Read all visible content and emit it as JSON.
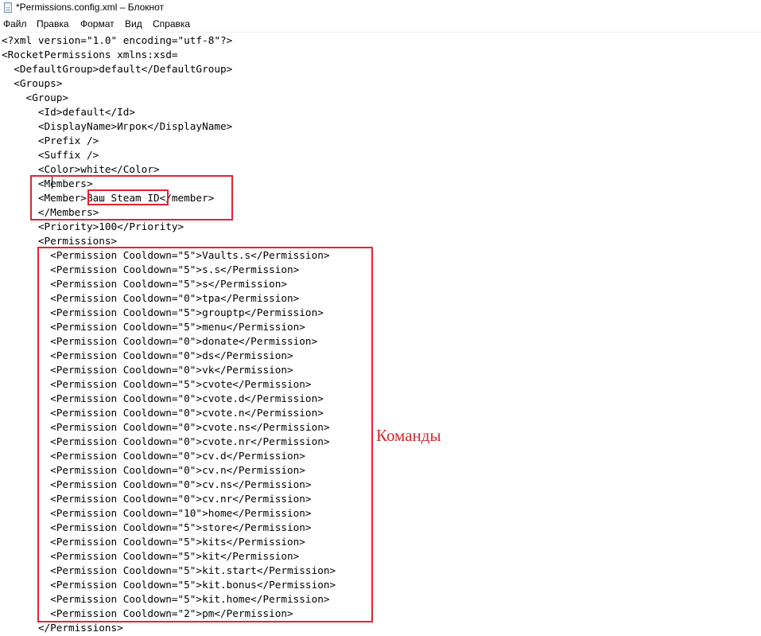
{
  "window": {
    "title": "*Permissions.config.xml – Блокнот",
    "icon": "notepad-icon"
  },
  "menu": [
    "Файл",
    "Правка",
    "Формат",
    "Вид",
    "Справка"
  ],
  "editor": {
    "lines": [
      "<?xml version=\"1.0\" encoding=\"utf-8\"?>",
      "<RocketPermissions xmlns:xsd=",
      "  <DefaultGroup>default</DefaultGroup>",
      "  <Groups>",
      "    <Group>",
      "      <Id>default</Id>",
      "      <DisplayName>Игрок</DisplayName>",
      "      <Prefix />",
      "      <Suffix />",
      "      <Color>white</Color>",
      "      <Members>",
      "      <Member>Ваш Steam ID</member>",
      "      </Members>",
      "      <Priority>100</Priority>",
      "      <Permissions>",
      "        <Permission Cooldown=\"5\">Vaults.s</Permission>",
      "        <Permission Cooldown=\"5\">s.s</Permission>",
      "        <Permission Cooldown=\"5\">s</Permission>",
      "        <Permission Cooldown=\"0\">tpa</Permission>",
      "        <Permission Cooldown=\"5\">grouptp</Permission>",
      "        <Permission Cooldown=\"5\">menu</Permission>",
      "        <Permission Cooldown=\"0\">donate</Permission>",
      "        <Permission Cooldown=\"0\">ds</Permission>",
      "        <Permission Cooldown=\"0\">vk</Permission>",
      "        <Permission Cooldown=\"5\">cvote</Permission>",
      "        <Permission Cooldown=\"0\">cvote.d</Permission>",
      "        <Permission Cooldown=\"0\">cvote.n</Permission>",
      "        <Permission Cooldown=\"0\">cvote.ns</Permission>",
      "        <Permission Cooldown=\"0\">cvote.nr</Permission>",
      "        <Permission Cooldown=\"0\">cv.d</Permission>",
      "        <Permission Cooldown=\"0\">cv.n</Permission>",
      "        <Permission Cooldown=\"0\">cv.ns</Permission>",
      "        <Permission Cooldown=\"0\">cv.nr</Permission>",
      "        <Permission Cooldown=\"10\">home</Permission>",
      "        <Permission Cooldown=\"5\">store</Permission>",
      "        <Permission Cooldown=\"5\">kits</Permission>",
      "        <Permission Cooldown=\"5\">kit</Permission>",
      "        <Permission Cooldown=\"5\">kit.start</Permission>",
      "        <Permission Cooldown=\"5\">kit.bonus</Permission>",
      "        <Permission Cooldown=\"5\">kit.home</Permission>",
      "        <Permission Cooldown=\"2\">pm</Permission>",
      "      </Permissions>"
    ]
  },
  "annotations": {
    "commands_label": "Команды",
    "color": "#e8212f"
  }
}
